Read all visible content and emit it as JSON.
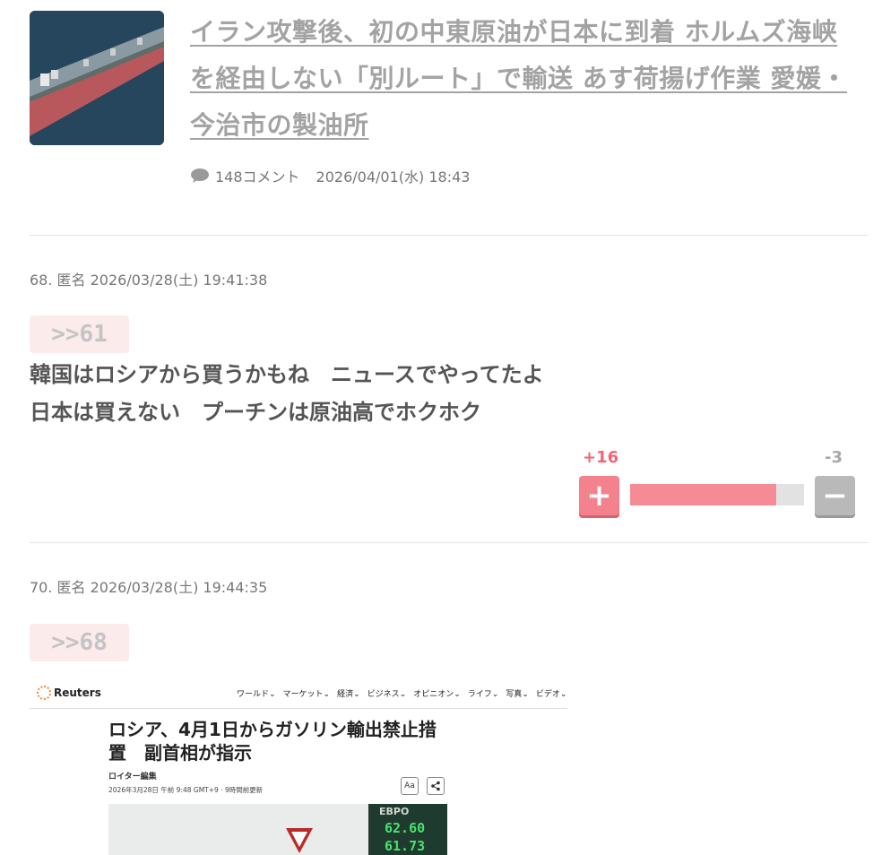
{
  "related_article": {
    "thumbnail": "tanker-ship-photo",
    "title": "イラン攻撃後、初の中東原油が日本に到着 ホルムズ海峡を経由しない「別ルート」で輸送 あす荷揚げ作業 愛媛・今治市の製油所",
    "comments": "148コメント",
    "datetime": "2026/04/01(水) 18:43",
    "comment_icon": "speech-bubble-icon"
  },
  "posts": [
    {
      "header": "68. 匿名 2026/03/28(土) 19:41:38",
      "anchor": ">>61",
      "lines": [
        "韓国はロシアから買うかもね　ニュースでやってたよ",
        "日本は買えない　プーチンは原油高でホクホク"
      ],
      "votes": {
        "plus": "+16",
        "minus": "-3",
        "ratio": 0.84
      }
    },
    {
      "header": "70. 匿名 2026/03/28(土) 19:44:35",
      "anchor": ">>68"
    }
  ],
  "embed": {
    "logo_text": "Reuters",
    "nav": [
      "ワールド⌄",
      "マーケット⌄",
      "経済⌄",
      "ビジネス⌄",
      "オピニオン⌄",
      "ライフ⌄",
      "写真⌄",
      "ビデオ⌄"
    ],
    "title": "ロシア、4月1日からガソリン輸出禁止措置　副首相が指示",
    "author": "ロイター編集",
    "date": "2026年3月28日 午前 9:48 GMT+9 · 9時間前更新",
    "font_button": "Aa",
    "board_label": "EBPO",
    "prices": [
      "62.60",
      "61.73"
    ]
  },
  "colors": {
    "plus": "#f06677",
    "minus": "#a8a8a8",
    "anchor_bg": "#fcebeb",
    "title_link": "#a3a3a3"
  }
}
